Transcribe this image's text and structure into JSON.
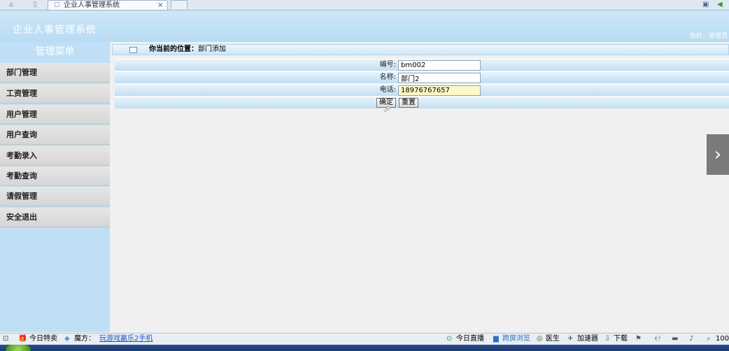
{
  "browser": {
    "tab_title": "企业人事管理系统",
    "tab_close": "×"
  },
  "header": {
    "app_title": "企业人事管理系统",
    "user_greeting": "你好，管理员"
  },
  "sidebar": {
    "title": "管理菜单",
    "items": [
      {
        "label": "部门管理"
      },
      {
        "label": "工资管理"
      },
      {
        "label": "用户管理"
      },
      {
        "label": "用户查询"
      },
      {
        "label": "考勤录入"
      },
      {
        "label": "考勤查询"
      },
      {
        "label": "请假管理"
      },
      {
        "label": "安全退出"
      }
    ]
  },
  "breadcrumb": {
    "prefix": "你当前的位置：",
    "current": "部门添加"
  },
  "form": {
    "fields": [
      {
        "label": "编号:",
        "value": "bm002"
      },
      {
        "label": "名称:",
        "value": "部门2"
      },
      {
        "label": "电话:",
        "value": "18976767657"
      }
    ],
    "submit_label": "确定",
    "reset_label": "重置"
  },
  "statusbar": {
    "today_special": "今日特卖",
    "magic_label": "魔方：",
    "magic_link": "玩游戏赢乐2手机",
    "live": "今日直播",
    "split_view": "跨屏浏览",
    "doctor": "医生",
    "accelerator": "加速器",
    "download": "下载",
    "zoom": "100"
  },
  "colors": {
    "header_bg": "#b8dcf4",
    "sidebar_bg": "#bedff5",
    "menu_item_bg": "#dcdcdc",
    "highlight_input": "#fdf8c8"
  }
}
